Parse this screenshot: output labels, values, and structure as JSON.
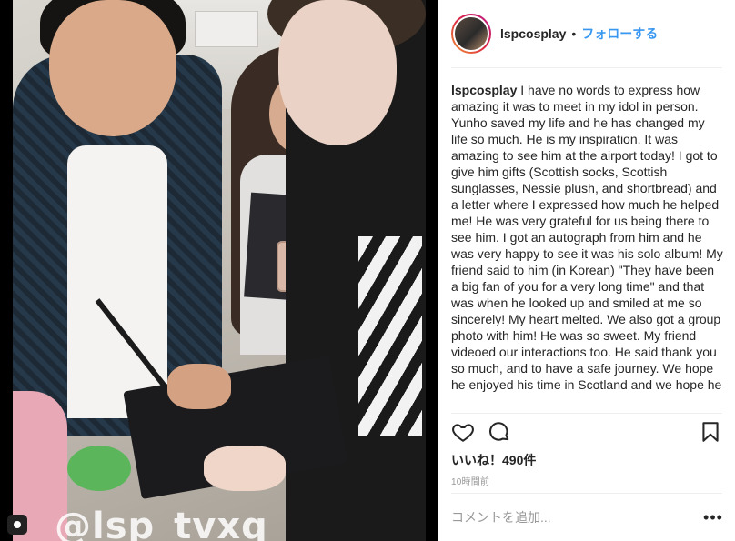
{
  "post": {
    "username": "lspcosplay",
    "separator": "•",
    "follow_label": "フォローする",
    "caption_text": "I have no words to express how amazing it was to meet in my idol in person. Yunho saved my life and he has changed my life so much. He is my inspiration. It was amazing to see him at the airport today! I got to give him gifts (Scottish socks, Scottish sunglasses, Nessie plush, and shortbread) and a letter where I expressed how much he helped me! He was very grateful for us being there to see him. I got an autograph from him and he was very happy to see it was his solo album! My friend said to him (in Korean) \"They have been a big fan of you for a very long time\" and that was when he looked up and smiled at me so sincerely! My heart melted. We also got a group photo with him! He was so sweet. My friend videoed our interactions too. He said thank you so much, and to have a safe journey. We hope he enjoyed his time in Scotland and we hope he",
    "likes_label": "いいね！490件",
    "timestamp": "10時間前",
    "comment_placeholder": "コメントを追加...",
    "more_label": "•••"
  },
  "media": {
    "watermark": "@lsp_tvxq",
    "type_badge_icon": "video-icon"
  },
  "icons": {
    "like": "heart-icon",
    "comment": "comment-icon",
    "save": "bookmark-icon",
    "more": "more-options-icon"
  },
  "colors": {
    "link_blue": "#3897f0",
    "text": "#262626",
    "muted": "#999999",
    "divider": "#efefef"
  }
}
